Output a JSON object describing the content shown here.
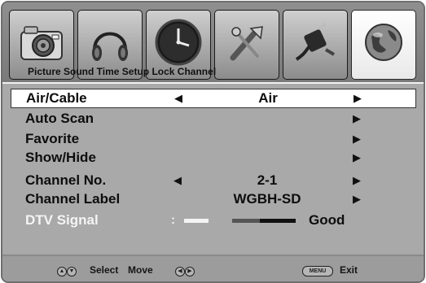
{
  "tabs": [
    {
      "name": "Picture",
      "icon": "camera-icon"
    },
    {
      "name": "Sound",
      "icon": "headphones-icon"
    },
    {
      "name": "Time",
      "icon": "clock-icon"
    },
    {
      "name": "Setup",
      "icon": "tools-icon"
    },
    {
      "name": "Lock",
      "icon": "plug-icon"
    },
    {
      "name": "Channel",
      "icon": "globe-icon",
      "active": true
    }
  ],
  "tab_labels_text": "Picture Sound Time Setup Lock Channel",
  "menu": {
    "air_cable": {
      "label": "Air/Cable",
      "value": "Air"
    },
    "auto_scan": {
      "label": "Auto Scan"
    },
    "favorite": {
      "label": "Favorite"
    },
    "show_hide": {
      "label": "Show/Hide"
    },
    "channel_no": {
      "label": "Channel No.",
      "value": "2-1"
    },
    "channel_label": {
      "label": "Channel Label",
      "value": "WGBH-SD"
    },
    "dtv_signal": {
      "label": "DTV Signal",
      "value": "Good"
    }
  },
  "footer": {
    "select": "Select",
    "move": "Move",
    "menu_button": "MENU",
    "exit": "Exit"
  },
  "colors": {
    "frame": "#a8a8a8",
    "selected_row": "#ffffff",
    "text": "#0d0d0d",
    "dim_text": "#f4f4f4"
  }
}
